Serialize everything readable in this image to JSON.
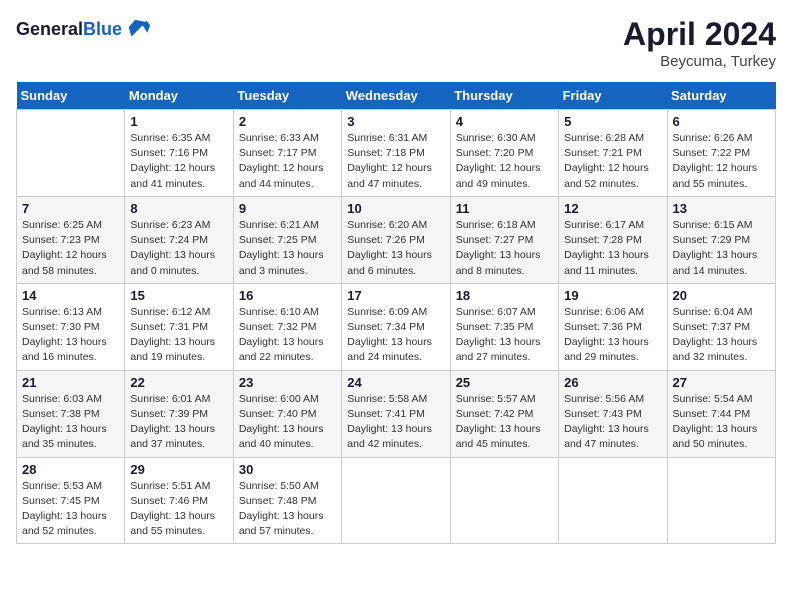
{
  "header": {
    "logo_line1": "General",
    "logo_line2": "Blue",
    "month_year": "April 2024",
    "location": "Beycuma, Turkey"
  },
  "days_of_week": [
    "Sunday",
    "Monday",
    "Tuesday",
    "Wednesday",
    "Thursday",
    "Friday",
    "Saturday"
  ],
  "weeks": [
    [
      {
        "num": "",
        "sunrise": "",
        "sunset": "",
        "daylight": ""
      },
      {
        "num": "1",
        "sunrise": "Sunrise: 6:35 AM",
        "sunset": "Sunset: 7:16 PM",
        "daylight": "Daylight: 12 hours and 41 minutes."
      },
      {
        "num": "2",
        "sunrise": "Sunrise: 6:33 AM",
        "sunset": "Sunset: 7:17 PM",
        "daylight": "Daylight: 12 hours and 44 minutes."
      },
      {
        "num": "3",
        "sunrise": "Sunrise: 6:31 AM",
        "sunset": "Sunset: 7:18 PM",
        "daylight": "Daylight: 12 hours and 47 minutes."
      },
      {
        "num": "4",
        "sunrise": "Sunrise: 6:30 AM",
        "sunset": "Sunset: 7:20 PM",
        "daylight": "Daylight: 12 hours and 49 minutes."
      },
      {
        "num": "5",
        "sunrise": "Sunrise: 6:28 AM",
        "sunset": "Sunset: 7:21 PM",
        "daylight": "Daylight: 12 hours and 52 minutes."
      },
      {
        "num": "6",
        "sunrise": "Sunrise: 6:26 AM",
        "sunset": "Sunset: 7:22 PM",
        "daylight": "Daylight: 12 hours and 55 minutes."
      }
    ],
    [
      {
        "num": "7",
        "sunrise": "Sunrise: 6:25 AM",
        "sunset": "Sunset: 7:23 PM",
        "daylight": "Daylight: 12 hours and 58 minutes."
      },
      {
        "num": "8",
        "sunrise": "Sunrise: 6:23 AM",
        "sunset": "Sunset: 7:24 PM",
        "daylight": "Daylight: 13 hours and 0 minutes."
      },
      {
        "num": "9",
        "sunrise": "Sunrise: 6:21 AM",
        "sunset": "Sunset: 7:25 PM",
        "daylight": "Daylight: 13 hours and 3 minutes."
      },
      {
        "num": "10",
        "sunrise": "Sunrise: 6:20 AM",
        "sunset": "Sunset: 7:26 PM",
        "daylight": "Daylight: 13 hours and 6 minutes."
      },
      {
        "num": "11",
        "sunrise": "Sunrise: 6:18 AM",
        "sunset": "Sunset: 7:27 PM",
        "daylight": "Daylight: 13 hours and 8 minutes."
      },
      {
        "num": "12",
        "sunrise": "Sunrise: 6:17 AM",
        "sunset": "Sunset: 7:28 PM",
        "daylight": "Daylight: 13 hours and 11 minutes."
      },
      {
        "num": "13",
        "sunrise": "Sunrise: 6:15 AM",
        "sunset": "Sunset: 7:29 PM",
        "daylight": "Daylight: 13 hours and 14 minutes."
      }
    ],
    [
      {
        "num": "14",
        "sunrise": "Sunrise: 6:13 AM",
        "sunset": "Sunset: 7:30 PM",
        "daylight": "Daylight: 13 hours and 16 minutes."
      },
      {
        "num": "15",
        "sunrise": "Sunrise: 6:12 AM",
        "sunset": "Sunset: 7:31 PM",
        "daylight": "Daylight: 13 hours and 19 minutes."
      },
      {
        "num": "16",
        "sunrise": "Sunrise: 6:10 AM",
        "sunset": "Sunset: 7:32 PM",
        "daylight": "Daylight: 13 hours and 22 minutes."
      },
      {
        "num": "17",
        "sunrise": "Sunrise: 6:09 AM",
        "sunset": "Sunset: 7:34 PM",
        "daylight": "Daylight: 13 hours and 24 minutes."
      },
      {
        "num": "18",
        "sunrise": "Sunrise: 6:07 AM",
        "sunset": "Sunset: 7:35 PM",
        "daylight": "Daylight: 13 hours and 27 minutes."
      },
      {
        "num": "19",
        "sunrise": "Sunrise: 6:06 AM",
        "sunset": "Sunset: 7:36 PM",
        "daylight": "Daylight: 13 hours and 29 minutes."
      },
      {
        "num": "20",
        "sunrise": "Sunrise: 6:04 AM",
        "sunset": "Sunset: 7:37 PM",
        "daylight": "Daylight: 13 hours and 32 minutes."
      }
    ],
    [
      {
        "num": "21",
        "sunrise": "Sunrise: 6:03 AM",
        "sunset": "Sunset: 7:38 PM",
        "daylight": "Daylight: 13 hours and 35 minutes."
      },
      {
        "num": "22",
        "sunrise": "Sunrise: 6:01 AM",
        "sunset": "Sunset: 7:39 PM",
        "daylight": "Daylight: 13 hours and 37 minutes."
      },
      {
        "num": "23",
        "sunrise": "Sunrise: 6:00 AM",
        "sunset": "Sunset: 7:40 PM",
        "daylight": "Daylight: 13 hours and 40 minutes."
      },
      {
        "num": "24",
        "sunrise": "Sunrise: 5:58 AM",
        "sunset": "Sunset: 7:41 PM",
        "daylight": "Daylight: 13 hours and 42 minutes."
      },
      {
        "num": "25",
        "sunrise": "Sunrise: 5:57 AM",
        "sunset": "Sunset: 7:42 PM",
        "daylight": "Daylight: 13 hours and 45 minutes."
      },
      {
        "num": "26",
        "sunrise": "Sunrise: 5:56 AM",
        "sunset": "Sunset: 7:43 PM",
        "daylight": "Daylight: 13 hours and 47 minutes."
      },
      {
        "num": "27",
        "sunrise": "Sunrise: 5:54 AM",
        "sunset": "Sunset: 7:44 PM",
        "daylight": "Daylight: 13 hours and 50 minutes."
      }
    ],
    [
      {
        "num": "28",
        "sunrise": "Sunrise: 5:53 AM",
        "sunset": "Sunset: 7:45 PM",
        "daylight": "Daylight: 13 hours and 52 minutes."
      },
      {
        "num": "29",
        "sunrise": "Sunrise: 5:51 AM",
        "sunset": "Sunset: 7:46 PM",
        "daylight": "Daylight: 13 hours and 55 minutes."
      },
      {
        "num": "30",
        "sunrise": "Sunrise: 5:50 AM",
        "sunset": "Sunset: 7:48 PM",
        "daylight": "Daylight: 13 hours and 57 minutes."
      },
      {
        "num": "",
        "sunrise": "",
        "sunset": "",
        "daylight": ""
      },
      {
        "num": "",
        "sunrise": "",
        "sunset": "",
        "daylight": ""
      },
      {
        "num": "",
        "sunrise": "",
        "sunset": "",
        "daylight": ""
      },
      {
        "num": "",
        "sunrise": "",
        "sunset": "",
        "daylight": ""
      }
    ]
  ]
}
